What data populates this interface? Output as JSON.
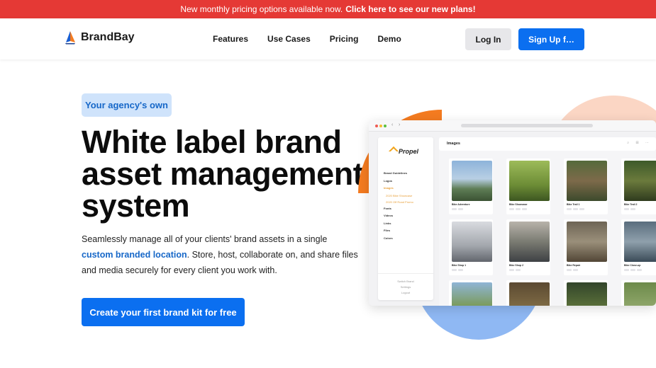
{
  "announcement": {
    "text": "New monthly pricing options available now.",
    "cta": "Click here to see our new plans!"
  },
  "nav": {
    "brand": "BrandBay",
    "links": [
      "Features",
      "Use Cases",
      "Pricing",
      "Demo"
    ],
    "login": "Log In",
    "signup": "Sign Up f…"
  },
  "hero": {
    "eyebrow": "Your agency's own",
    "headline": "White label brand asset management system",
    "desc_before": "Seamlessly manage all of your clients' brand assets in a single ",
    "desc_link": "custom branded location",
    "desc_after": ". Store, host, collaborate on, and share files and media securely for every client you work with.",
    "cta": "Create your first brand kit for free"
  },
  "mockup": {
    "app_logo": "Propel",
    "main_title": "Images",
    "sidebar": [
      "Brand Guidelines",
      "Logos",
      "Images",
      "2020 Bike Showcase",
      "2020 Off Road Promo",
      "Fonts",
      "Videos",
      "Links",
      "Files",
      "Colors"
    ],
    "sidebar_footer": [
      "Switch Brand",
      "Settings",
      "Logout"
    ],
    "cards": [
      "Bike Adventure",
      "Bike Showcase",
      "Bike Trail 1",
      "Bike Trail 2",
      "Bike Shop 1",
      "Bike Shop 2",
      "Bike Repair",
      "Bike Close-up",
      "",
      "",
      "",
      ""
    ]
  },
  "colors": {
    "announcement_bg": "#e53935",
    "primary": "#0b6ff0",
    "eyebrow_bg": "#cfe3fb",
    "accent_orange": "#f47b20",
    "accent_peach": "#fbd6c4",
    "accent_blue": "#8fb8f3"
  }
}
